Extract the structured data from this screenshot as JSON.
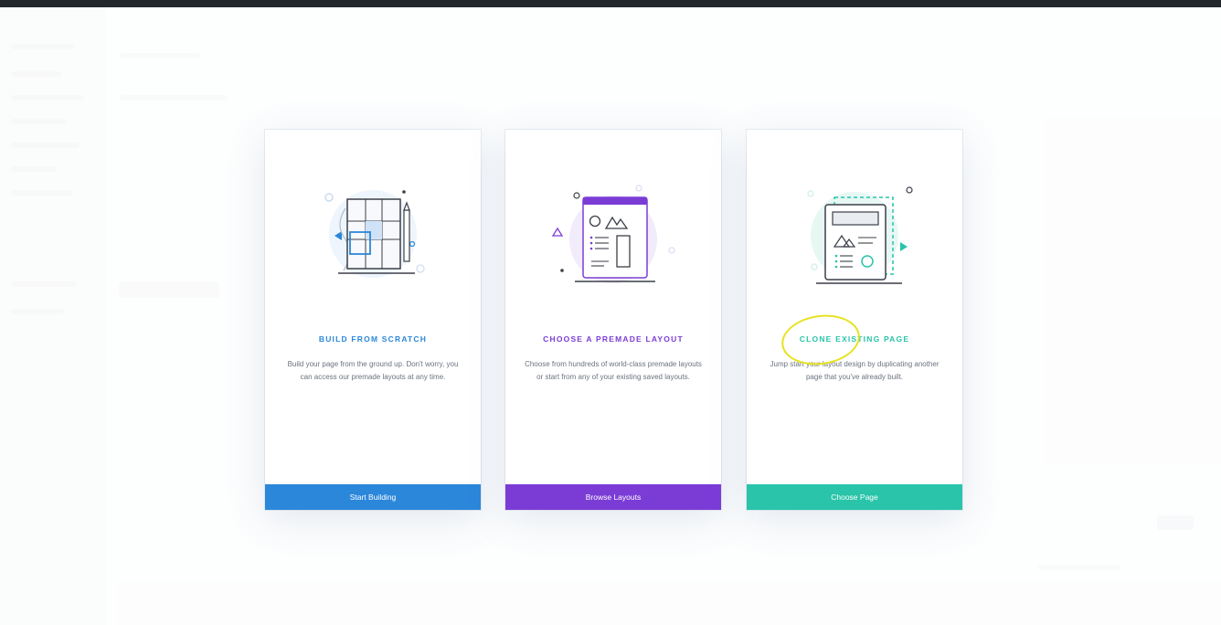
{
  "colors": {
    "blue": "#2b87da",
    "purple": "#7b3cd6",
    "teal": "#29c4a9",
    "annotation": "#e6e321"
  },
  "cards": [
    {
      "title": "BUILD FROM SCRATCH",
      "description": "Build your page from the ground up. Don't worry, you can access our premade layouts at any time.",
      "button_label": "Start Building",
      "icon": "blueprint-grid-icon"
    },
    {
      "title": "CHOOSE A PREMADE LAYOUT",
      "description": "Choose from hundreds of world-class premade layouts or start from any of your existing saved layouts.",
      "button_label": "Browse Layouts",
      "icon": "layout-page-icon"
    },
    {
      "title": "CLONE EXISTING PAGE",
      "description": "Jump start your layout design by duplicating another page that you've already built.",
      "button_label": "Choose Page",
      "icon": "cloned-page-icon"
    }
  ]
}
